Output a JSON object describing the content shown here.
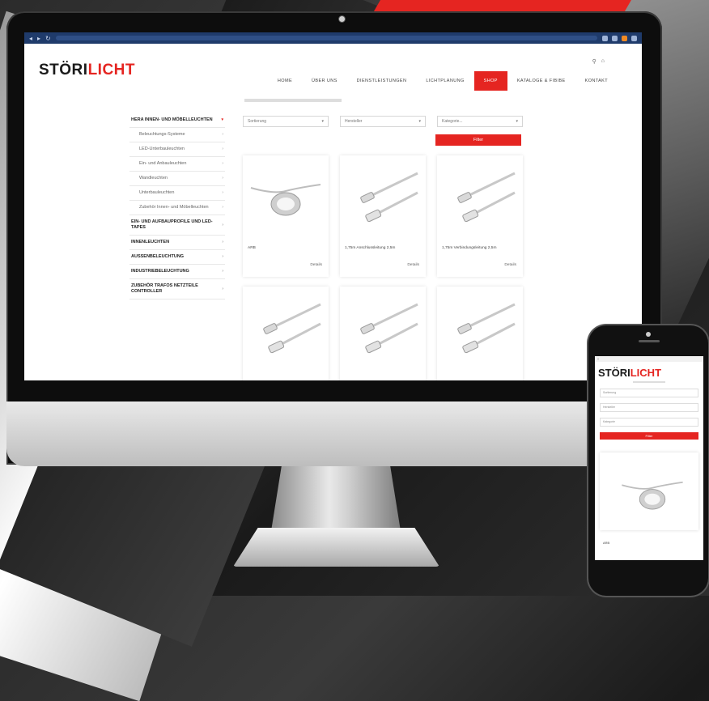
{
  "brand": {
    "logo_part1": "STÖRI",
    "logo_part2": "LICHT",
    "red": "#e52521"
  },
  "nav": {
    "items": [
      "HOME",
      "ÜBER UNS",
      "DIENSTLEISTUNGEN",
      "LICHTPLANUNG",
      "SHOP",
      "KATALOGE & FIBIBE",
      "KONTAKT"
    ],
    "active_index": 4
  },
  "sidebar": {
    "items": [
      {
        "label": "HERA INNEN- UND MÖBELLEUCHTEN",
        "type": "main",
        "active": true
      },
      {
        "label": "Beleuchtungs-Systeme",
        "type": "sub"
      },
      {
        "label": "LED-Unterbauleuchten",
        "type": "sub"
      },
      {
        "label": "Ein- und Anbauleuchten",
        "type": "sub"
      },
      {
        "label": "Wandleuchten",
        "type": "sub"
      },
      {
        "label": "Unterbauleuchten",
        "type": "sub"
      },
      {
        "label": "Zubehör Innen- und Möbelleuchten",
        "type": "sub"
      },
      {
        "label": "EIN- UND AUFBAUPROFILE UND LED-TAPES",
        "type": "main"
      },
      {
        "label": "INNENLEUCHTEN",
        "type": "main"
      },
      {
        "label": "AUSSENBELEUCHTUNG",
        "type": "main"
      },
      {
        "label": "INDUSTRIEBELEUCHTUNG",
        "type": "main"
      },
      {
        "label": "ZUBEHÖR TRAFOS NETZTEILE CONTROLLER",
        "type": "main"
      }
    ]
  },
  "filters": {
    "selects": [
      "Sortierung",
      "Hersteller",
      "Kategorie..."
    ],
    "button": "Filter"
  },
  "products": [
    {
      "title": "ARB",
      "detail": "Details",
      "image": "puck-light"
    },
    {
      "title": "1,75m Anschlussleitung 2,5m",
      "detail": "Details",
      "image": "cable"
    },
    {
      "title": "1,75m Verbindungsleitung 2,5m",
      "detail": "Details",
      "image": "cable"
    },
    {
      "title": "",
      "detail": "",
      "image": "cable"
    },
    {
      "title": "",
      "detail": "",
      "image": "cable"
    },
    {
      "title": "",
      "detail": "",
      "image": "cable"
    }
  ],
  "phone": {
    "filters": [
      "Sortierung",
      "Hersteller",
      "Kategorie"
    ],
    "button": "Filter",
    "product_title": "ARB"
  }
}
